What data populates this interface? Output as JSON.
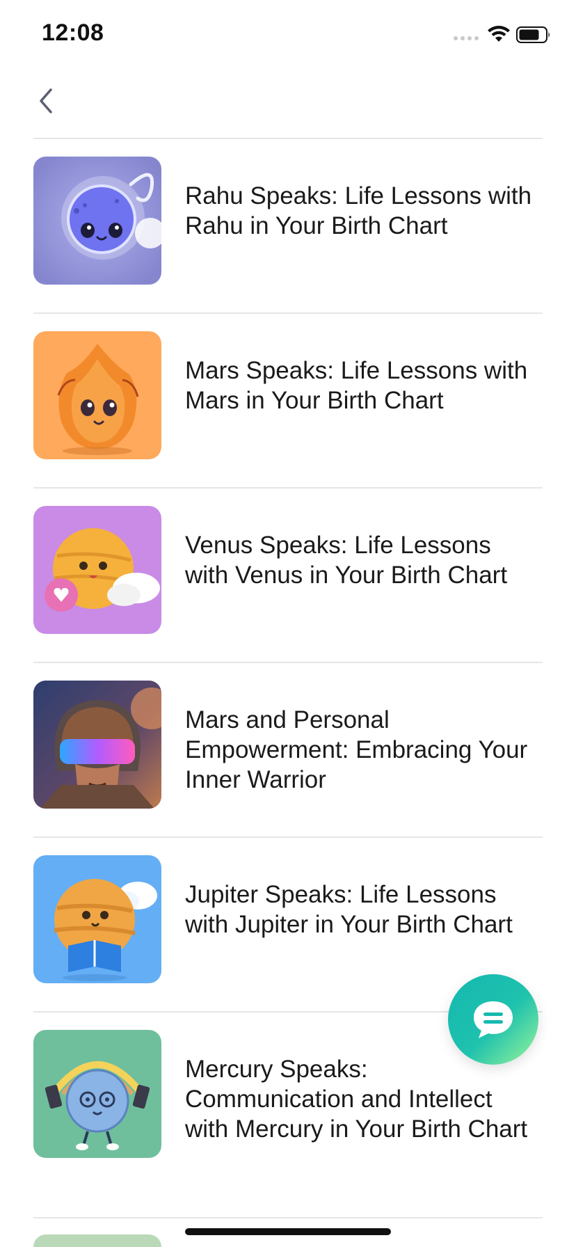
{
  "status_bar": {
    "time": "12:08"
  },
  "nav": {
    "back_icon": "chevron-left-icon"
  },
  "articles": [
    {
      "title": "Rahu Speaks: Life Lessons with Rahu in Your Birth Chart",
      "thumb_bg": "#8f8fd6"
    },
    {
      "title": "Mars Speaks: Life Lessons with Mars in Your Birth Chart",
      "thumb_bg": "#ffa95c"
    },
    {
      "title": "Venus Speaks: Life Lessons with Venus in Your Birth Chart",
      "thumb_bg": "#c98be6"
    },
    {
      "title": "Mars and Personal Empowerment: Embracing Your Inner Warrior",
      "thumb_bg": "#3b3f5e"
    },
    {
      "title": "Jupiter Speaks: Life Lessons with Jupiter in Your Birth Chart",
      "thumb_bg": "#64aef5"
    },
    {
      "title": "Mercury Speaks: Communication and Intellect with Mercury in Your Birth Chart",
      "thumb_bg": "#6fbf9c"
    }
  ],
  "chat_fab": {
    "icon": "chat-bubble-icon",
    "colors": [
      "#14b8b0",
      "#9cf59a"
    ]
  }
}
